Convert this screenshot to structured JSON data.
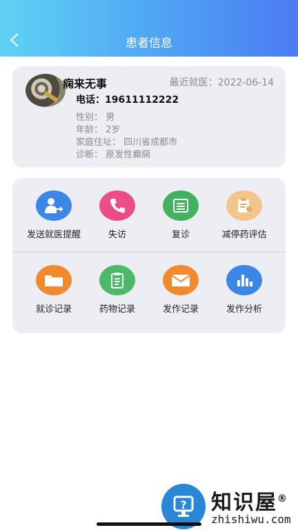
{
  "header": {
    "title": "患者信息"
  },
  "patient": {
    "name": "痫来无事",
    "last_visit": "最近就医：2022-06-14",
    "phone": "电话：19611112222",
    "gender": "性别：  男",
    "age": "年龄：  2岁",
    "address": "家庭住址：  四川省成都市",
    "diagnosis": "诊断：  原发性癫痫"
  },
  "functions": [
    {
      "label": "发送就医提醒",
      "icon": "person-arrow-icon",
      "color": "#3b86e6"
    },
    {
      "label": "失访",
      "icon": "phone-icon",
      "color": "#ec4d86"
    },
    {
      "label": "复诊",
      "icon": "document-stack-icon",
      "color": "#43b25f"
    },
    {
      "label": "减停药评估",
      "icon": "clipboard-check-icon",
      "color": "#f3c58c"
    },
    {
      "label": "就诊记录",
      "icon": "folder-icon",
      "color": "#f08a2e"
    },
    {
      "label": "药物记录",
      "icon": "clipboard-icon",
      "color": "#4cb968"
    },
    {
      "label": "发作记录",
      "icon": "envelope-icon",
      "color": "#f08a2e"
    },
    {
      "label": "发作分析",
      "icon": "bar-chart-icon",
      "color": "#3b86e6"
    }
  ],
  "watermark": {
    "text": "知识屋",
    "registered": "®",
    "url": "zhishiwu.com"
  }
}
